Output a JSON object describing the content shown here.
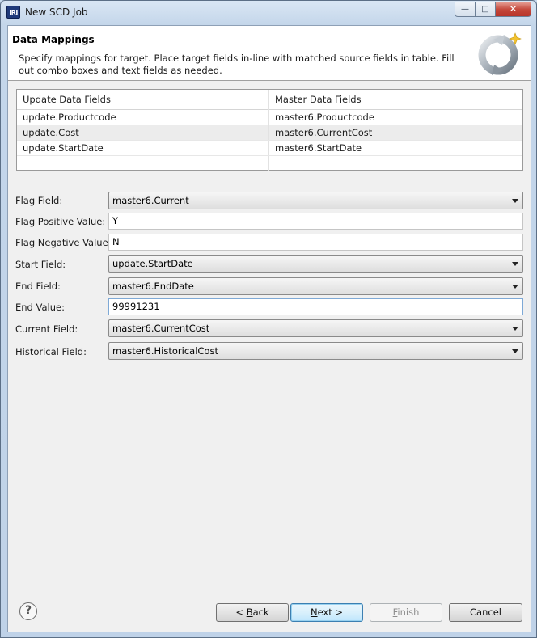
{
  "window": {
    "title": "New SCD Job",
    "app_logo_text": "IRI"
  },
  "header": {
    "title": "Data Mappings",
    "description": "Specify mappings for target. Place target fields in-line with matched source fields in table. Fill out combo boxes and text fields as needed."
  },
  "table": {
    "columns": [
      "Update Data Fields",
      "Master Data Fields"
    ],
    "rows": [
      [
        "update.Productcode",
        "master6.Productcode"
      ],
      [
        "update.Cost",
        "master6.CurrentCost"
      ],
      [
        "update.StartDate",
        "master6.StartDate"
      ],
      [
        "",
        ""
      ]
    ]
  },
  "form": {
    "flag_field": {
      "label": "Flag Field:",
      "value": "master6.Current"
    },
    "flag_positive": {
      "label": "Flag Positive Value:",
      "value": "Y"
    },
    "flag_negative": {
      "label": "Flag Negative Value:",
      "value": "N"
    },
    "start_field": {
      "label": "Start Field:",
      "value": "update.StartDate"
    },
    "end_field": {
      "label": "End Field:",
      "value": "master6.EndDate"
    },
    "end_value": {
      "label": "End Value:",
      "value": "99991231"
    },
    "current_field": {
      "label": "Current Field:",
      "value": "master6.CurrentCost"
    },
    "historical_field": {
      "label": "Historical Field:",
      "value": "master6.HistoricalCost"
    }
  },
  "buttons": {
    "help": "?",
    "back_prefix": "< ",
    "back_mnemonic": "B",
    "back_rest": "ack",
    "next_mnemonic": "N",
    "next_rest": "ext >",
    "finish_mnemonic": "F",
    "finish_rest": "inish",
    "cancel": "Cancel"
  },
  "window_controls": {
    "minimize": "—",
    "maximize": "□",
    "close": "✕"
  }
}
